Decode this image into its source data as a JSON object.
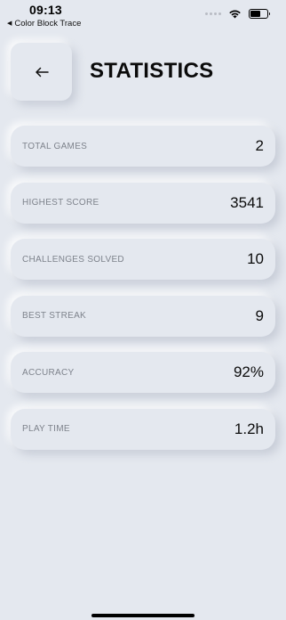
{
  "status_bar": {
    "time": "09:13",
    "back_app_label": "Color Block Trace"
  },
  "header": {
    "back_icon": "arrow-left-icon",
    "title": "STATISTICS"
  },
  "stats": [
    {
      "label": "TOTAL GAMES",
      "value": "2"
    },
    {
      "label": "HIGHEST SCORE",
      "value": "3541"
    },
    {
      "label": "CHALLENGES SOLVED",
      "value": "10"
    },
    {
      "label": "BEST STREAK",
      "value": "9"
    },
    {
      "label": "ACCURACY",
      "value": "92%"
    },
    {
      "label": "PLAY TIME",
      "value": "1.2h"
    }
  ],
  "colors": {
    "background": "#e4e8ef",
    "label": "#7e838c",
    "value": "#0c0c0c"
  }
}
